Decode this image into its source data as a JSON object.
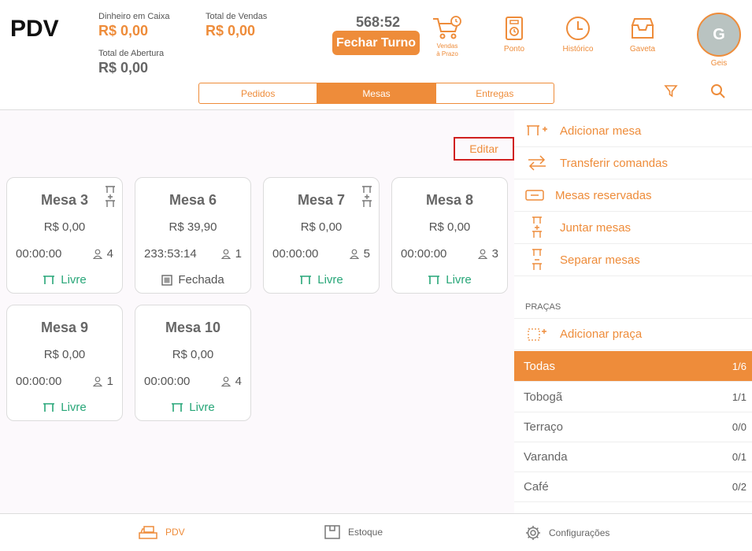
{
  "header": {
    "brand": "PDV",
    "cash_label": "Dinheiro em Caixa",
    "cash_value": "R$ 0,00",
    "sales_label": "Total de Vendas",
    "sales_value": "R$ 0,00",
    "opening_label": "Total de Abertura",
    "opening_value": "R$ 0,00",
    "timer": "568:52",
    "close_shift": "Fechar Turno",
    "buttons": {
      "credit_sales": "Vendas\nà Prazo",
      "clock_in": "Ponto",
      "history": "Histórico",
      "drawer": "Gaveta"
    },
    "user_initial": "G",
    "user_name": "Geis"
  },
  "tabs": [
    "Pedidos",
    "Mesas",
    "Entregas"
  ],
  "active_tab": "Mesas",
  "edit_label": "Editar",
  "tables": [
    {
      "name": "Mesa 3",
      "amount": "R$ 0,00",
      "time": "00:00:00",
      "seats": "4",
      "status": "Livre"
    },
    {
      "name": "Mesa 6",
      "amount": "R$ 39,90",
      "time": "233:53:14",
      "seats": "1",
      "status": "Fechada"
    },
    {
      "name": "Mesa 7",
      "amount": "R$ 0,00",
      "time": "00:00:00",
      "seats": "5",
      "status": "Livre"
    },
    {
      "name": "Mesa 8",
      "amount": "R$ 0,00",
      "time": "00:00:00",
      "seats": "3",
      "status": "Livre"
    },
    {
      "name": "Mesa 9",
      "amount": "R$ 0,00",
      "time": "00:00:00",
      "seats": "1",
      "status": "Livre"
    },
    {
      "name": "Mesa 10",
      "amount": "R$ 0,00",
      "time": "00:00:00",
      "seats": "4",
      "status": "Livre"
    }
  ],
  "actions": {
    "add_table": "Adicionar mesa",
    "transfer": "Transferir comandas",
    "reserved": "Mesas reservadas",
    "join": "Juntar mesas",
    "split": "Separar mesas"
  },
  "pracas_title": "PRAÇAS",
  "add_praca": "Adicionar praça",
  "pracas": [
    {
      "name": "Todas",
      "count": "1/6"
    },
    {
      "name": "Tobogã",
      "count": "1/1"
    },
    {
      "name": "Terraço",
      "count": "0/0"
    },
    {
      "name": "Varanda",
      "count": "0/1"
    },
    {
      "name": "Café",
      "count": "0/2"
    }
  ],
  "bottom_nav": {
    "pdv": "PDV",
    "stock": "Estoque",
    "settings": "Configurações"
  },
  "colors": {
    "accent": "#ee8c3a",
    "free": "#27a678",
    "highlight_border": "#d0201f"
  }
}
